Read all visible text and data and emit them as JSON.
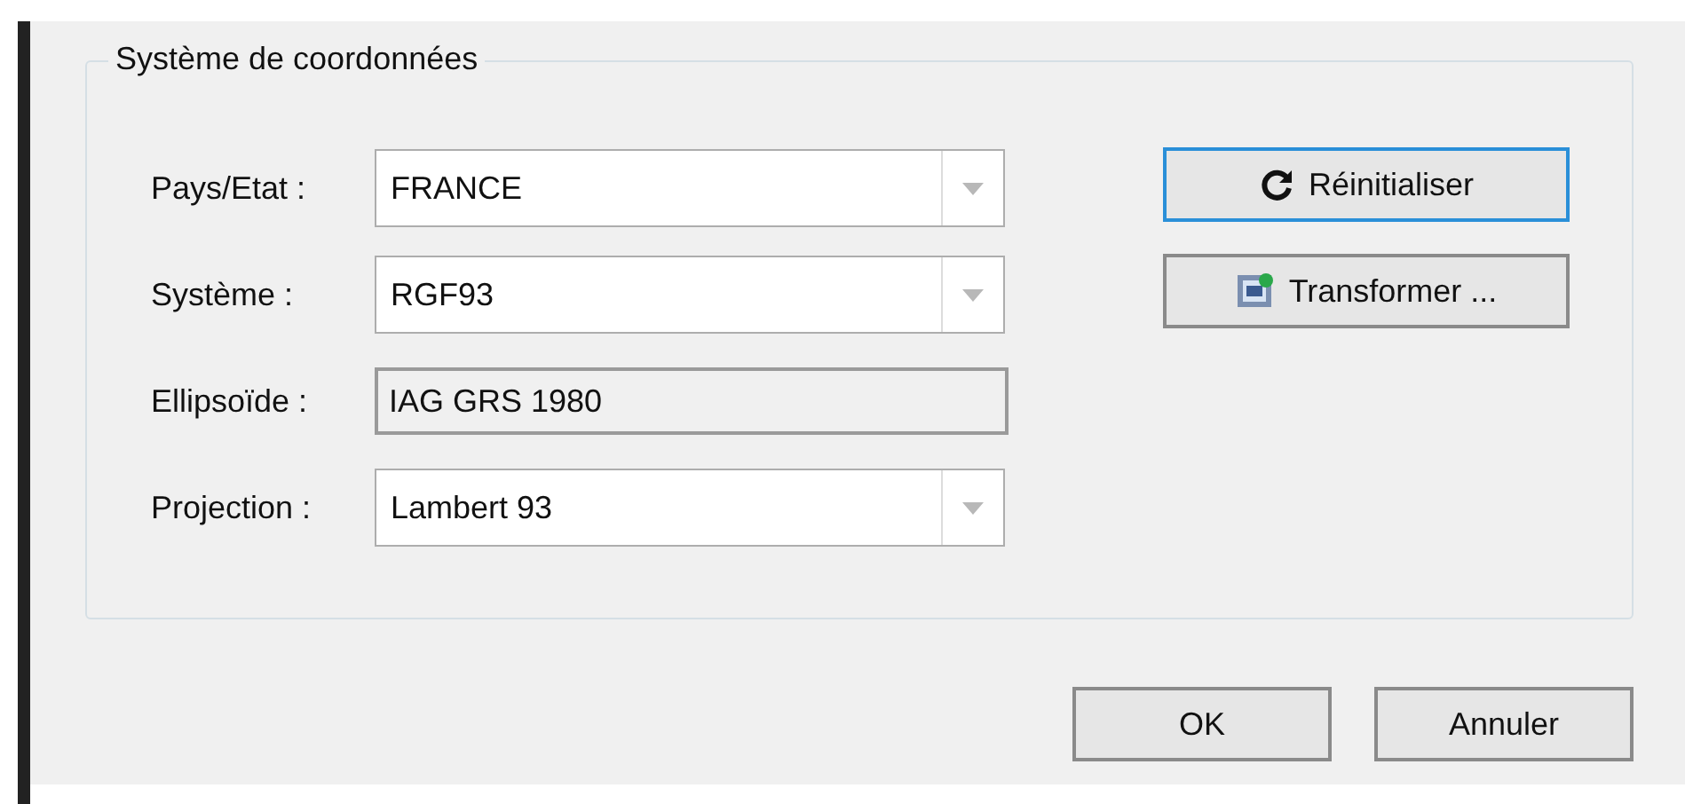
{
  "group": {
    "title": "Système de coordonnées"
  },
  "fields": [
    {
      "label": "Pays/Etat :",
      "value": "FRANCE",
      "kind": "dropdown"
    },
    {
      "label": "Système :",
      "value": "RGF93",
      "kind": "dropdown"
    },
    {
      "label": "Ellipsoïde :",
      "value": "IAG GRS 1980",
      "kind": "readonly"
    },
    {
      "label": "Projection :",
      "value": "Lambert 93",
      "kind": "dropdown"
    }
  ],
  "side_buttons": [
    {
      "label": "Réinitialiser",
      "kind": "refresh",
      "focused": true
    },
    {
      "label": "Transformer ...",
      "kind": "transform",
      "focused": false
    }
  ],
  "buttons": [
    {
      "label": "OK",
      "focused": false
    },
    {
      "label": "Annuler",
      "focused": false
    }
  ]
}
